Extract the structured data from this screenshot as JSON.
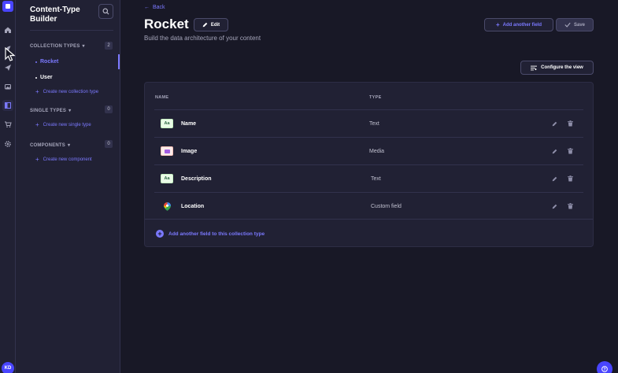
{
  "rail": {
    "avatar_initials": "KD",
    "icons": [
      "home-icon",
      "feather-icon",
      "paper-plane-icon",
      "images-icon",
      "layout-icon",
      "cart-icon",
      "gear-icon"
    ]
  },
  "subnav": {
    "title": "Content-Type Builder",
    "collection_types": {
      "label": "COLLECTION TYPES",
      "count": "2",
      "items": [
        {
          "label": "Rocket",
          "active": true
        },
        {
          "label": "User",
          "active": false
        }
      ],
      "create_label": "Create new collection type"
    },
    "single_types": {
      "label": "SINGLE TYPES",
      "count": "0",
      "create_label": "Create new single type"
    },
    "components": {
      "label": "COMPONENTS",
      "count": "0",
      "create_label": "Create new component"
    }
  },
  "header": {
    "back_label": "Back",
    "title": "Rocket",
    "edit_label": "Edit",
    "subtitle": "Build the data architecture of your content",
    "add_field_label": "Add another field",
    "save_label": "Save",
    "configure_label": "Configure the view"
  },
  "table": {
    "columns": [
      "NAME",
      "TYPE"
    ],
    "rows": [
      {
        "name": "Name",
        "type": "Text",
        "icon": "text-type-icon",
        "icon_text": "Aa"
      },
      {
        "name": "Image",
        "type": "Media",
        "icon": "media-type-icon",
        "icon_text": ""
      },
      {
        "name": "Description",
        "type": "Text",
        "icon": "text-type-icon",
        "icon_text": "Aa"
      },
      {
        "name": "Location",
        "type": "Custom field",
        "icon": "map-pin-icon",
        "icon_text": ""
      }
    ],
    "footer_add_label": "Add another field to this collection type"
  },
  "colors": {
    "accent": "#7b79ff",
    "brand": "#4945ff",
    "background": "#181826",
    "panel": "#212134"
  }
}
